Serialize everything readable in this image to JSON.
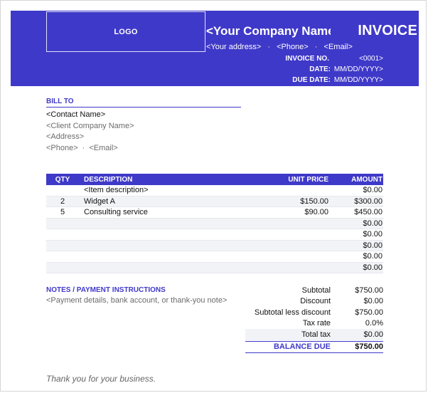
{
  "header": {
    "logo_label": "LOGO",
    "company_name": "<Your Company Name>",
    "invoice_title": "INVOICE",
    "company_contact": {
      "address": "<Your address>",
      "phone": "<Phone>",
      "email": "<Email>",
      "separator": "·"
    },
    "meta": {
      "invoice_no_label": "INVOICE NO.",
      "invoice_no_value": "<0001>",
      "date_label": "DATE:",
      "date_value": "MM/DD/YYYY>",
      "due_date_label": "DUE DATE:",
      "due_date_value": "MM/DD/YYYY>"
    }
  },
  "bill_to": {
    "title": "BILL TO",
    "contact_name": "<Contact Name>",
    "client_company_name": "<Client Company Name>",
    "address": "<Address>",
    "phone": "<Phone>",
    "email": "<Email>",
    "separator": "·"
  },
  "items_table": {
    "headers": {
      "qty": "QTY",
      "description": "DESCRIPTION",
      "unit_price": "UNIT PRICE",
      "amount": "AMOUNT"
    },
    "rows": [
      {
        "qty": "",
        "description": "<Item description>",
        "unit_price": "",
        "amount": "$0.00"
      },
      {
        "qty": "2",
        "description": "Widget A",
        "unit_price": "$150.00",
        "amount": "$300.00"
      },
      {
        "qty": "5",
        "description": "Consulting service",
        "unit_price": "$90.00",
        "amount": "$450.00"
      },
      {
        "qty": "",
        "description": "",
        "unit_price": "",
        "amount": "$0.00"
      },
      {
        "qty": "",
        "description": "",
        "unit_price": "",
        "amount": "$0.00"
      },
      {
        "qty": "",
        "description": "",
        "unit_price": "",
        "amount": "$0.00"
      },
      {
        "qty": "",
        "description": "",
        "unit_price": "",
        "amount": "$0.00"
      },
      {
        "qty": "",
        "description": "",
        "unit_price": "",
        "amount": "$0.00"
      }
    ]
  },
  "notes": {
    "title": "NOTES / PAYMENT INSTRUCTIONS",
    "text": "<Payment details, bank account, or thank-you note>"
  },
  "totals": {
    "subtotal_label": "Subtotal",
    "subtotal_value": "$750.00",
    "discount_label": "Discount",
    "discount_value": "$0.00",
    "subtotal_less_discount_label": "Subtotal less discount",
    "subtotal_less_discount_value": "$750.00",
    "tax_rate_label": "Tax rate",
    "tax_rate_value": "0.0%",
    "total_tax_label": "Total tax",
    "total_tax_value": "$0.00",
    "balance_due_label": "BALANCE DUE",
    "balance_due_value": "$750.00"
  },
  "footer": {
    "thanks": "Thank you for your business."
  },
  "colors": {
    "brand": "#3f39c9",
    "stripe": "#f2f3f6",
    "muted_text": "#6b6b6b"
  }
}
